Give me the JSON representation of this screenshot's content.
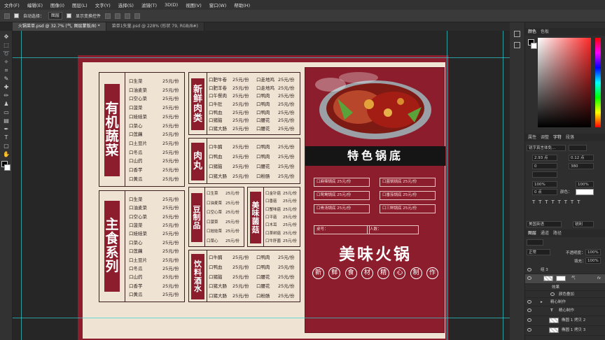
{
  "menu": [
    "文件(F)",
    "编辑(E)",
    "图像(I)",
    "图层(L)",
    "文字(Y)",
    "选择(S)",
    "滤镜(T)",
    "3D(D)",
    "视图(V)",
    "窗口(W)",
    "帮助(H)"
  ],
  "options": {
    "auto_select": "自动选择：",
    "auto_select_value": "图层",
    "show_transform": "显示变换控件"
  },
  "tabs": [
    "火锅菜单.psd @ 32.7% (气, 图层蒙版/8) *",
    "菜单1矢量.psd @ 228% (形状 79, RGB/8#)"
  ],
  "menu_doc": {
    "organic": {
      "title": [
        "有",
        "机",
        "蔬",
        "菜"
      ],
      "names": [
        "口生菜",
        "口油麦菜",
        "口空心菜",
        "口菠菜",
        "口娃娃菜",
        "口菜心",
        "口莲藕",
        "口土豆片",
        "口冬瓜",
        "口山药",
        "口香芋",
        "口黄瓜"
      ],
      "prices": [
        "25元/份",
        "25元/份",
        "25元/份",
        "25元/份",
        "25元/份",
        "25元/份",
        "25元/份",
        "25元/份",
        "25元/份",
        "25元/份",
        "25元/份",
        "25元/份"
      ]
    },
    "staple": {
      "title": [
        "主",
        "食",
        "系",
        "列"
      ],
      "names": [
        "口生菜",
        "口油麦菜",
        "口空心菜",
        "口菠菜",
        "口娃娃菜",
        "口菜心",
        "口莲藕",
        "口土豆片",
        "口冬瓜",
        "口山药",
        "口香芋",
        "口黄瓜"
      ],
      "prices": [
        "25元/份",
        "25元/份",
        "25元/份",
        "25元/份",
        "25元/份",
        "25元/份",
        "25元/份",
        "25元/份",
        "25元/份",
        "25元/份",
        "25元/份",
        "25元/份"
      ]
    },
    "meat": {
      "title": [
        "新",
        "鲜",
        "肉",
        "类"
      ],
      "left": [
        "口肥牛卷",
        "口肥羊卷",
        "口午餐肉",
        "口牛肚",
        "口鸭血",
        "口猪脑",
        "口猪大肠"
      ],
      "left_price": [
        "25元/份",
        "25元/份",
        "25元/份",
        "25元/份",
        "25元/份",
        "25元/份",
        "25元/份"
      ],
      "right": [
        "口走地鸡",
        "口走地鸡",
        "口鸭肉",
        "口鸭肉",
        "口鸭肉",
        "口腰花",
        "口腰花"
      ],
      "right_price": [
        "25元/份",
        "25元/份",
        "25元/份",
        "25元/份",
        "25元/份",
        "25元/份",
        "25元/份"
      ]
    },
    "balls": {
      "title": [
        "肉",
        "丸"
      ],
      "left": [
        "口牛腩",
        "口鸭血",
        "口猪脑",
        "口猪大肠"
      ],
      "left_price": [
        "25元/份",
        "25元/份",
        "25元/份",
        "25元/份"
      ],
      "right": [
        "口鸭肉",
        "口鸭肉",
        "口腰花",
        "口粉肠"
      ],
      "right_price": [
        "25元/份",
        "25元/份",
        "25元/份",
        "25元/份"
      ]
    },
    "tofu": {
      "title": [
        "豆",
        "制",
        "品"
      ],
      "names": [
        "口生菜",
        "口油麦菜",
        "口空心菜",
        "口菠菜",
        "口娃娃菜",
        "口菜心"
      ],
      "prices": [
        "25元/份",
        "25元/份",
        "25元/份",
        "25元/份",
        "25元/份",
        "25元/份"
      ]
    },
    "mushroom": {
      "title": [
        "美",
        "味",
        "菌",
        "菇"
      ],
      "names": [
        "口金针菇",
        "口香菇",
        "口蟹味菇",
        "口平菇",
        "口木耳",
        "口茶树菇",
        "口牛肝菌"
      ],
      "prices": [
        "25元/份",
        "25元/份",
        "25元/份",
        "25元/份",
        "25元/份",
        "25元/份",
        "25元/份"
      ]
    },
    "drinks": {
      "title": [
        "饮",
        "料",
        "酒",
        "水"
      ],
      "left": [
        "口牛腩",
        "口鸭血",
        "口猪脑",
        "口猪大肠",
        "口猪大肠"
      ],
      "left_price": [
        "25元/份",
        "25元/份",
        "25元/份",
        "25元/份",
        "25元/份"
      ],
      "right": [
        "口鸭肉",
        "口鸭肉",
        "口腰花",
        "口腰花",
        "口粉肠"
      ],
      "right_price": [
        "25元/份",
        "25元/份",
        "25元/份",
        "25元/份",
        "25元/份"
      ]
    },
    "broth": {
      "banner": "特色锅底",
      "items": [
        "口麻辣锅底  25元/份",
        "口菌锅锅底  25元/份",
        "口鸳鸯锅底  25元/份",
        "口番茄锅底  25元/份",
        "口骨汤锅底  25元/份",
        "口三鲜锅底  25元/份"
      ],
      "table_label": "桌号：",
      "people_label": "人数：",
      "big_title": "美味火锅",
      "slogan": [
        "新",
        "鲜",
        "食",
        "材",
        "精",
        "心",
        "制",
        "作"
      ]
    }
  },
  "right": {
    "color_tabs": [
      "颜色",
      "色板"
    ],
    "char_tabs": [
      "属性",
      "调整",
      "字符",
      "段落"
    ],
    "font": "锐字真言体免...",
    "size": "2.93 点",
    "lead": "0.12 点",
    "va": "0",
    "tracking": "380",
    "scale_v": "100%",
    "scale_h": "100%",
    "baseline": "0 点",
    "color_label": "颜色：",
    "lang": "美国英语",
    "aa": "锐利",
    "layer_tabs": [
      "图层",
      "通道",
      "路径"
    ],
    "blend": "正常",
    "opacity_label": "不透明度：",
    "opacity": "100%",
    "fill_label": "填充：",
    "fill": "100%",
    "layers": [
      "组 3",
      "气",
      "效果",
      "颜色叠加",
      "精心制作",
      "精心制作",
      "椭圆 1 拷贝 2",
      "椭圆 1 拷贝 3"
    ]
  },
  "colors": {
    "accent": "#8c1d2c",
    "paper": "#efe4d3"
  }
}
